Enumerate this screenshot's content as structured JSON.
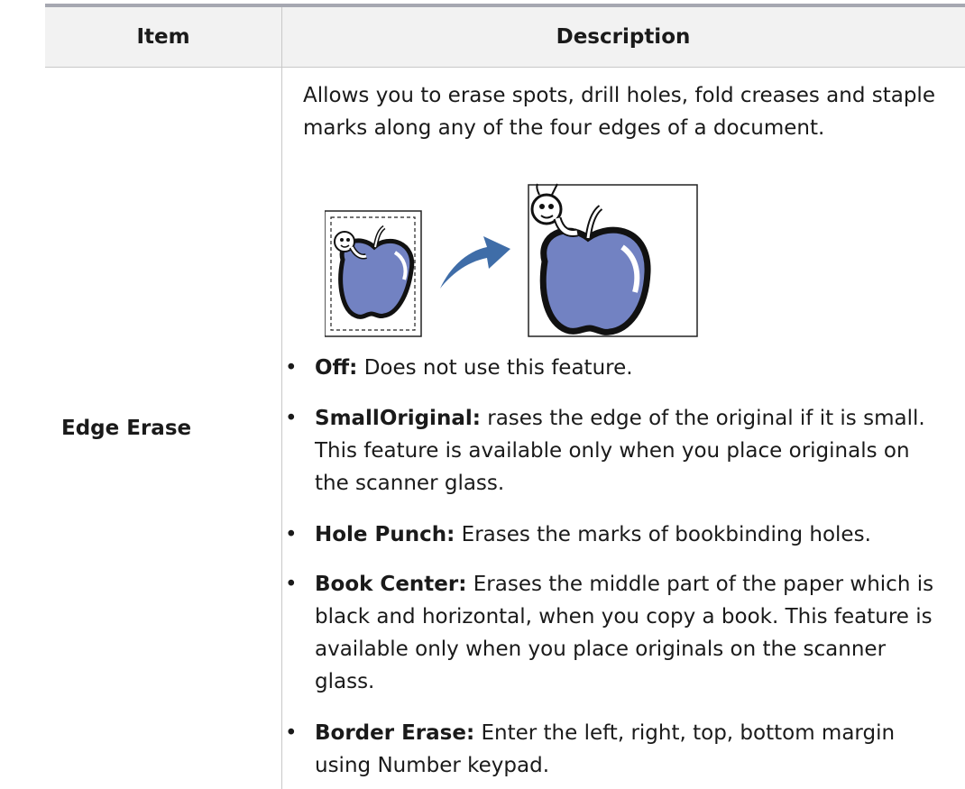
{
  "table": {
    "header": {
      "item": "Item",
      "description": "Description"
    },
    "row": {
      "item_name": "Edge Erase",
      "intro": "Allows you to erase spots, drill holes, fold creases and staple marks along any of the four edges of a document.",
      "options": [
        {
          "label": "Off:",
          "text": "Does not use this feature."
        },
        {
          "label": "SmallOriginal:",
          "text": "rases the edge of the original if it is small. This feature is available only when you place originals on the scanner glass."
        },
        {
          "label": "Hole Punch:",
          "text": "Erases the marks of bookbinding holes."
        },
        {
          "label": "Book Center:",
          "text": "Erases the middle part of the paper which is black and horizontal, when you copy a book. This feature is available only when you place originals on the scanner glass."
        },
        {
          "label": "Border Erase:",
          "text": "Enter the left, right, top, bottom margin using Number keypad."
        }
      ]
    }
  },
  "illustration": {
    "before_icon": "apple-worm-small-icon",
    "arrow_icon": "curved-arrow-icon",
    "after_icon": "apple-worm-large-icon",
    "apple_color": "#7282c2",
    "arrow_color": "#3f6da8"
  }
}
